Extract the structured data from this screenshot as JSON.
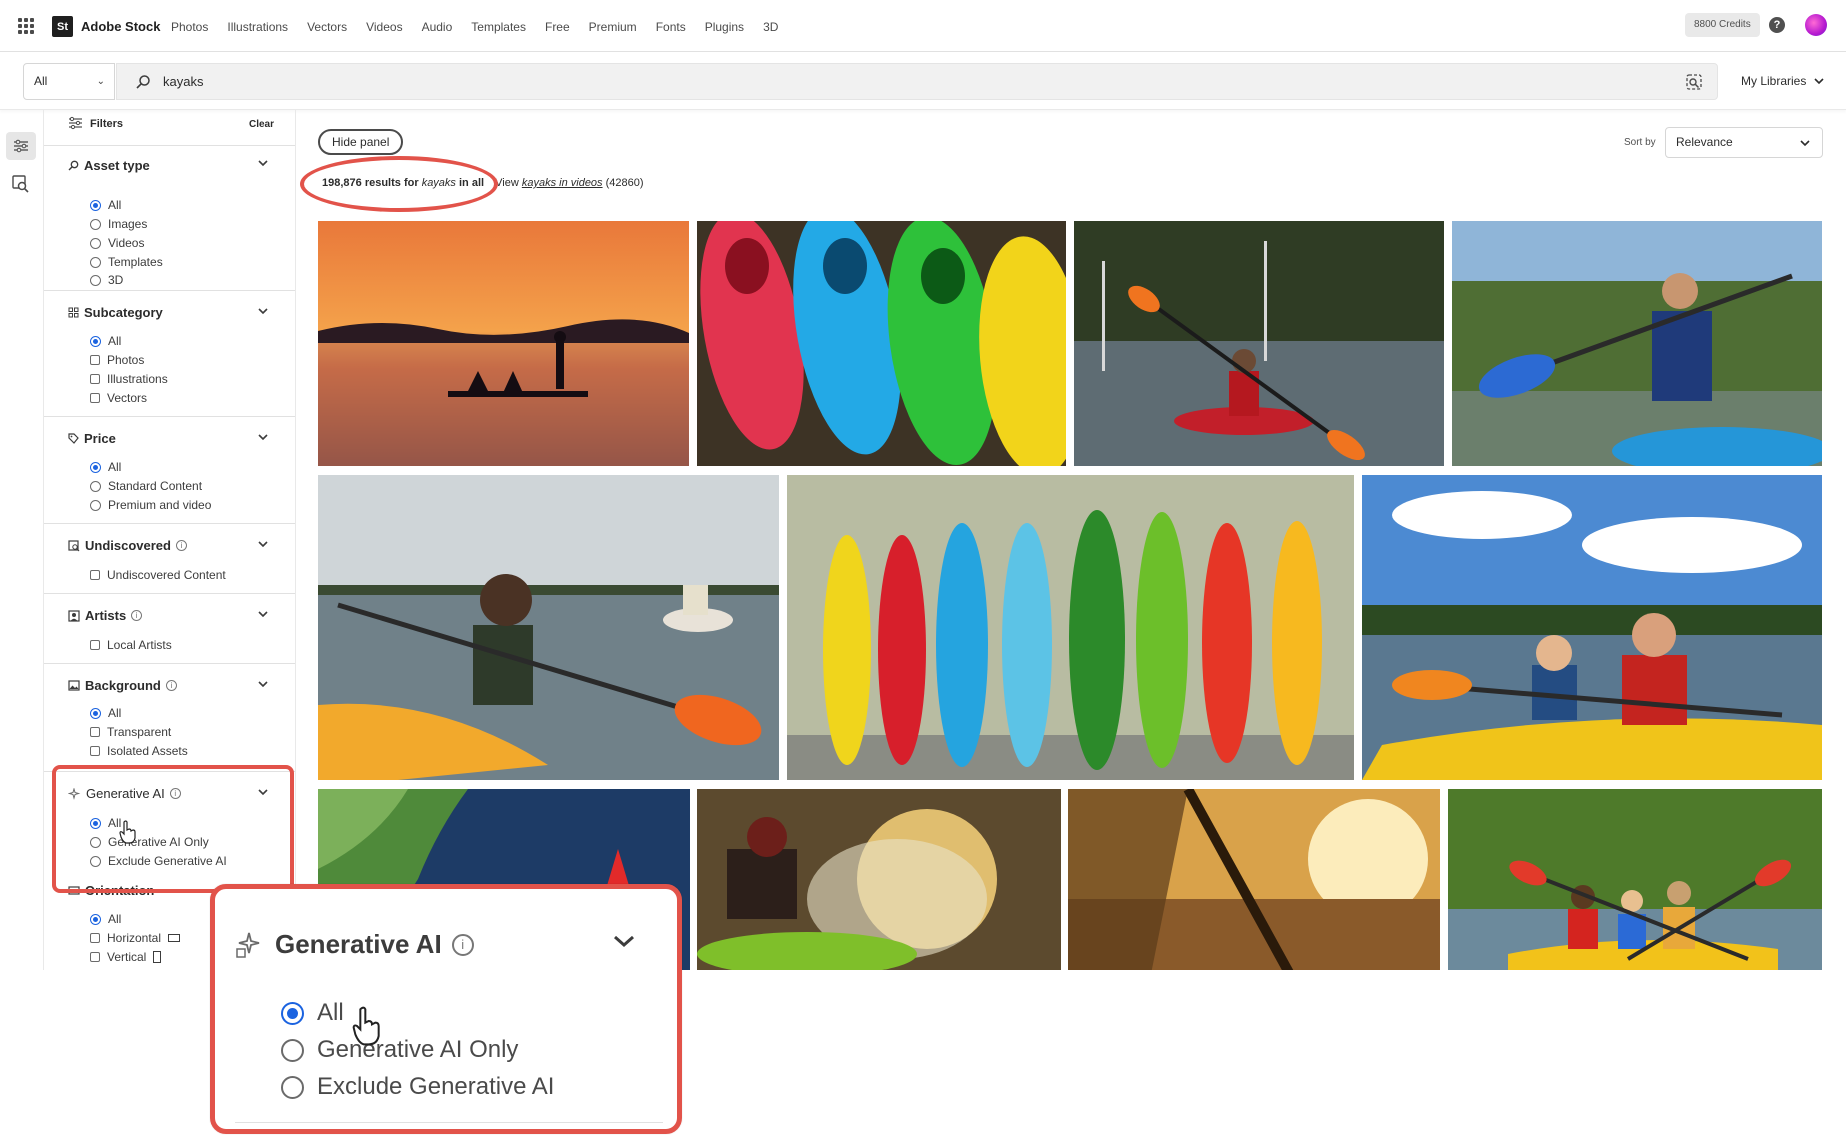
{
  "brand": {
    "logo": "St",
    "name": "Adobe Stock"
  },
  "nav": [
    "Photos",
    "Illustrations",
    "Vectors",
    "Videos",
    "Audio",
    "Templates",
    "Free",
    "Premium",
    "Fonts",
    "Plugins",
    "3D"
  ],
  "header": {
    "credits": "8800 Credits",
    "help": "?"
  },
  "search": {
    "scope": "All",
    "query": "kayaks",
    "libraries": "My Libraries"
  },
  "filters": {
    "title": "Filters",
    "clear": "Clear",
    "asset_type": {
      "title": "Asset type",
      "options": [
        "All",
        "Images",
        "Videos",
        "Templates",
        "3D"
      ],
      "selected": "All"
    },
    "subcategory": {
      "title": "Subcategory",
      "options": [
        "All",
        "Photos",
        "Illustrations",
        "Vectors"
      ],
      "selected": "All"
    },
    "price": {
      "title": "Price",
      "options": [
        "All",
        "Standard Content",
        "Premium and video"
      ],
      "selected": "All"
    },
    "undiscovered": {
      "title": "Undiscovered",
      "options": [
        "Undiscovered Content"
      ]
    },
    "artists": {
      "title": "Artists",
      "options": [
        "Local Artists"
      ]
    },
    "background": {
      "title": "Background",
      "options": [
        "All",
        "Transparent",
        "Isolated Assets"
      ],
      "selected": "All"
    },
    "generative_ai": {
      "title": "Generative AI",
      "options": [
        "All",
        "Generative AI Only",
        "Exclude Generative AI"
      ],
      "selected": "All"
    },
    "orientation": {
      "title": "Orientation",
      "options": [
        "All",
        "Horizontal",
        "Vertical"
      ],
      "selected": "All"
    }
  },
  "toolbar": {
    "hide_panel": "Hide panel",
    "sort_label": "Sort by",
    "sort_value": "Relevance"
  },
  "results": {
    "count": "198,876 results for",
    "term": "kayaks",
    "in": "in all",
    "view_prefix": "View",
    "view_link": "kayaks in videos",
    "video_count": "(42860)"
  },
  "images": [
    {
      "name": "sunset-paddlers"
    },
    {
      "name": "colorful-kayaks-on-dock"
    },
    {
      "name": "woman-red-kayak"
    },
    {
      "name": "man-blue-paddle"
    },
    {
      "name": "woman-yellow-kayak"
    },
    {
      "name": "kayaks-against-wall"
    },
    {
      "name": "father-son-kayak"
    },
    {
      "name": "river-aerial"
    },
    {
      "name": "splashing-kayaker"
    },
    {
      "name": "sunset-paddle-closeup"
    },
    {
      "name": "family-yellow-kayak"
    }
  ],
  "zoom": {
    "title": "Generative AI",
    "options": [
      "All",
      "Generative AI Only",
      "Exclude Generative AI"
    ],
    "selected": "All"
  },
  "colors": {
    "accent": "#1b63e0",
    "highlight": "#e2534a"
  }
}
